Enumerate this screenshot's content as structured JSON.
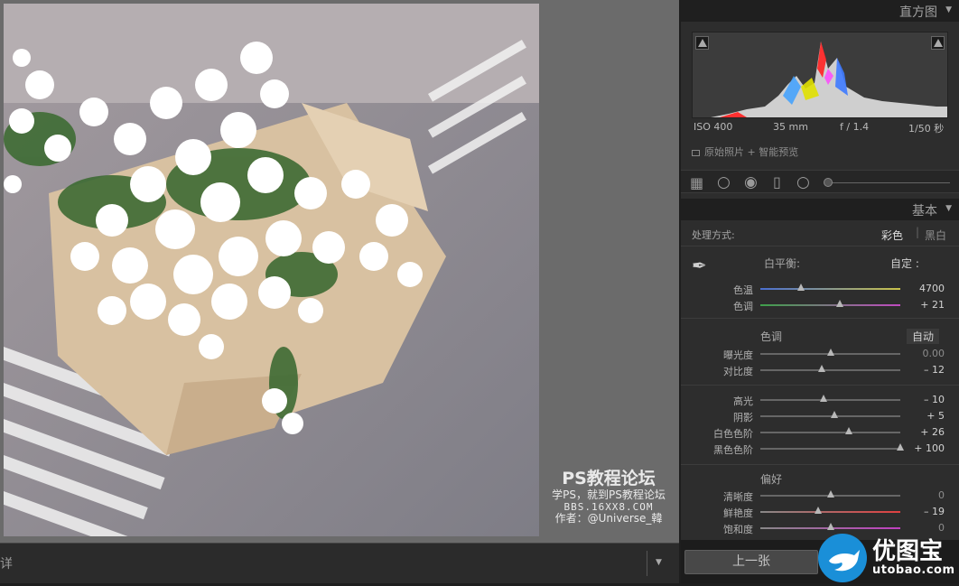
{
  "histogram": {
    "title": "直方图",
    "iso": "ISO 400",
    "focal": "35 mm",
    "aperture": "f / 1.4",
    "shutter": "1/50 秒",
    "preview_note": "原始照片 + 智能预览"
  },
  "basic": {
    "title": "基本",
    "treatment_label": "处理方式:",
    "treatment_color": "彩色",
    "treatment_bw": "黑白",
    "wb_label": "白平衡:",
    "wb_value": "自定 :",
    "tone_title": "色调",
    "tone_auto": "自动",
    "presence_title": "偏好",
    "rows": [
      {
        "label": "色温",
        "value": "4700",
        "pos": 0.29
      },
      {
        "label": "色调",
        "value": "+ 21",
        "pos": 0.57
      },
      {
        "label": "曝光度",
        "value": "0.00",
        "pos": 0.5
      },
      {
        "label": "对比度",
        "value": "– 12",
        "pos": 0.44
      },
      {
        "label": "高光",
        "value": "– 10",
        "pos": 0.45
      },
      {
        "label": "阴影",
        "value": "+ 5",
        "pos": 0.53
      },
      {
        "label": "白色色阶",
        "value": "+ 26",
        "pos": 0.63
      },
      {
        "label": "黑色色阶",
        "value": "+ 100",
        "pos": 1.0
      },
      {
        "label": "清晰度",
        "value": "0",
        "pos": 0.5
      },
      {
        "label": "鲜艳度",
        "value": "– 19",
        "pos": 0.41
      },
      {
        "label": "饱和度",
        "value": "0",
        "pos": 0.5
      }
    ]
  },
  "buttons": {
    "previous": "上一张"
  },
  "bottom_label": "详",
  "watermark": {
    "title": "PS教程论坛",
    "sub": "学PS，就到PS教程论坛",
    "url": "BBS.16XX8.COM",
    "author": "作者：@Universe_韓"
  },
  "logo": {
    "name": "优图宝",
    "url": "utobao.com"
  },
  "colors": {
    "panel_bg": "#2d2d2d",
    "header_bg": "#1f1f1f",
    "canvas_bg": "#6b6b6b"
  }
}
